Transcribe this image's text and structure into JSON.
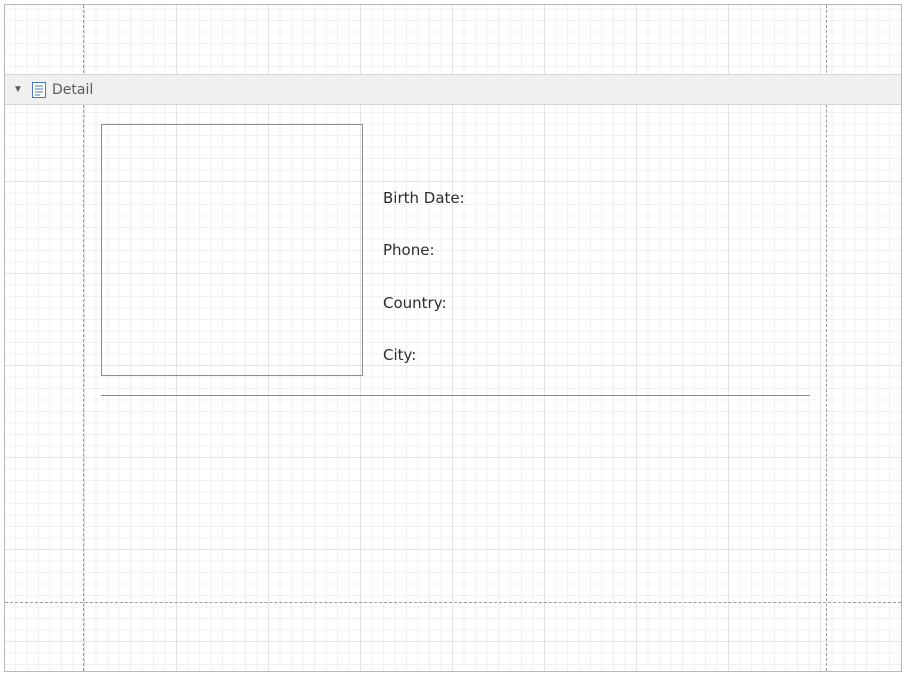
{
  "band": {
    "name": "Detail",
    "toggle_icon": "triangle-down-icon",
    "band_icon": "detail-band-icon",
    "collapsed": false
  },
  "fields": [
    {
      "label": "Birth Date:"
    },
    {
      "label": "Phone:"
    },
    {
      "label": "Country:"
    },
    {
      "label": "City:"
    }
  ],
  "colors": {
    "band_header_bg": "#f0f0f0",
    "grid_minor": "#f0f0f0",
    "grid_major": "#e3e3e3",
    "icon_blue": "#4a7ab8",
    "label_text": "#2c2c2c"
  }
}
